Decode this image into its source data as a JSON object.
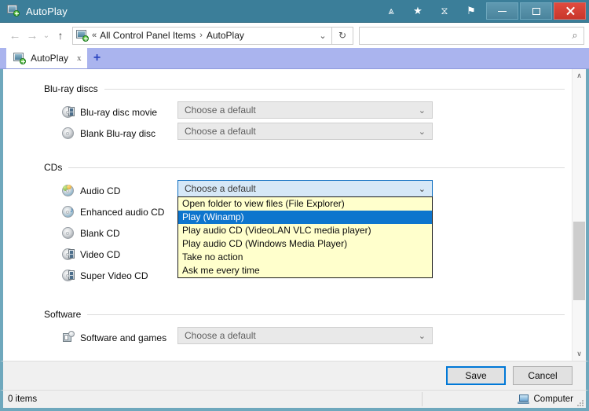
{
  "window": {
    "title": "AutoPlay",
    "app_icon": "autoplay-icon",
    "titlebar_color": "#3b7e99",
    "tools": [
      {
        "name": "chevrons-down-icon",
        "glyph": "⩓"
      },
      {
        "name": "star-icon",
        "glyph": "★"
      },
      {
        "name": "history-icon",
        "glyph": "⧖"
      },
      {
        "name": "pin-icon",
        "glyph": "⚑"
      }
    ],
    "caption": {
      "minimize": "minimize-button",
      "maximize": "maximize-button",
      "close": "close-button",
      "close_color": "#cc3629"
    }
  },
  "navbar": {
    "back": "←",
    "forward": "→",
    "recent": "⌄",
    "up": "↑",
    "breadcrumb": {
      "overflow": "«",
      "items": [
        "All Control Panel Items",
        "AutoPlay"
      ],
      "separator": "›",
      "dropdown": "⌄"
    },
    "refresh": "↻",
    "search": {
      "value": "",
      "placeholder": "",
      "icon": "search-icon",
      "icon_glyph": "⌕"
    }
  },
  "tabstrip": {
    "tab_color": "#aab4ee",
    "tabs": [
      {
        "label": "AutoPlay",
        "close": "x",
        "icon": "autoplay-icon"
      }
    ],
    "new_tab": "+"
  },
  "groups": [
    {
      "id": "bluray",
      "title": "Blu-ray discs",
      "rows": [
        {
          "label": "Blu-ray disc movie",
          "icon": "bluray-movie-disc-icon",
          "combo": "Choose a default"
        },
        {
          "label": "Blank Blu-ray disc",
          "icon": "blank-disc-icon",
          "combo": "Choose a default"
        }
      ]
    },
    {
      "id": "cds",
      "title": "CDs",
      "rows": [
        {
          "label": "Audio CD",
          "icon": "audio-cd-icon",
          "combo": "Choose a default"
        },
        {
          "label": "Enhanced audio CD",
          "icon": "enhanced-audio-cd-icon",
          "combo": ""
        },
        {
          "label": "Blank CD",
          "icon": "blank-disc-icon",
          "combo": ""
        },
        {
          "label": "Video CD",
          "icon": "video-cd-icon",
          "combo": ""
        },
        {
          "label": "Super Video CD",
          "icon": "super-video-cd-icon",
          "combo": ""
        }
      ]
    },
    {
      "id": "software",
      "title": "Software",
      "rows": [
        {
          "label": "Software and games",
          "icon": "software-games-icon",
          "combo": "Choose a default"
        }
      ]
    }
  ],
  "dropdown": {
    "owner": "Audio CD",
    "background": "#ffffcc",
    "highlight": "#0d75cd",
    "selected_index": 1,
    "items": [
      "Open folder to view files (File Explorer)",
      "Play (Winamp)",
      "Play audio CD (VideoLAN VLC media player)",
      "Play audio CD (Windows Media Player)",
      "Take no action",
      "Ask me every time"
    ]
  },
  "footer": {
    "save_label": "Save",
    "cancel_label": "Cancel",
    "focus_color": "#0078d7"
  },
  "statusbar": {
    "items_text": "0 items",
    "location_text": "Computer",
    "location_icon": "computer-icon"
  },
  "scrollbar": {
    "up_arrow": "∧",
    "down_arrow": "∨"
  }
}
